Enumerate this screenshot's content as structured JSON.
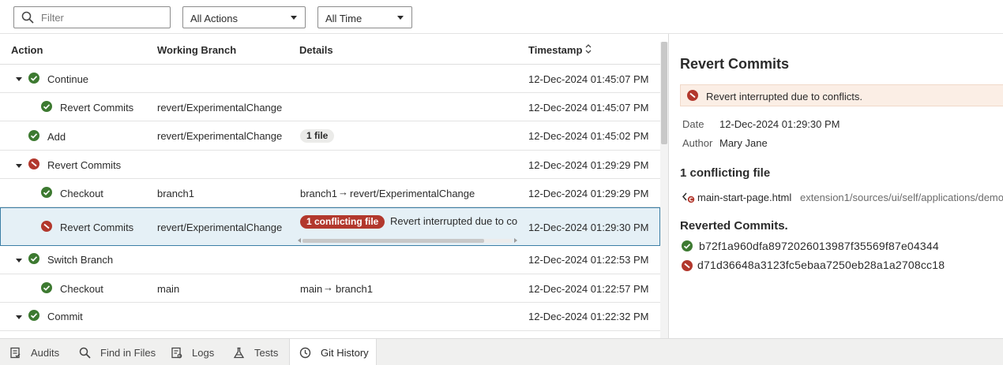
{
  "toolbar": {
    "filter_placeholder": "Filter",
    "action_select": "All Actions",
    "time_select": "All Time"
  },
  "table": {
    "columns": [
      "Action",
      "Working Branch",
      "Details",
      "Timestamp"
    ],
    "rows": [
      {
        "action": "Continue",
        "status": "ok",
        "branch": "",
        "details": "",
        "timestamp": "12-Dec-2024 01:45:07 PM",
        "expanded": true,
        "level": 0
      },
      {
        "action": "Revert Commits",
        "status": "ok",
        "branch": "revert/ExperimentalChange",
        "details": "",
        "timestamp": "12-Dec-2024 01:45:07 PM",
        "level": 1
      },
      {
        "action": "Add",
        "status": "ok",
        "branch": "revert/ExperimentalChange",
        "badge": "1 file",
        "timestamp": "12-Dec-2024 01:45:02 PM",
        "level": 0
      },
      {
        "action": "Revert Commits",
        "status": "err",
        "branch": "",
        "details": "",
        "timestamp": "12-Dec-2024 01:29:29 PM",
        "expanded": true,
        "level": 0
      },
      {
        "action": "Checkout",
        "status": "ok",
        "branch": "branch1",
        "from": "branch1",
        "to": "revert/ExperimentalChange",
        "timestamp": "12-Dec-2024 01:29:29 PM",
        "level": 1
      },
      {
        "action": "Revert Commits",
        "status": "err",
        "branch": "revert/ExperimentalChange",
        "badge": "1 conflicting file",
        "details": "Revert interrupted due to conflicts.",
        "timestamp": "12-Dec-2024 01:29:30 PM",
        "level": 1,
        "selected": true
      },
      {
        "action": "Switch Branch",
        "status": "ok",
        "branch": "",
        "details": "",
        "timestamp": "12-Dec-2024 01:22:53 PM",
        "expanded": true,
        "level": 0
      },
      {
        "action": "Checkout",
        "status": "ok",
        "branch": "main",
        "from": "main",
        "to": "branch1",
        "timestamp": "12-Dec-2024 01:22:57 PM",
        "level": 1
      },
      {
        "action": "Commit",
        "status": "ok",
        "branch": "",
        "details": "",
        "timestamp": "12-Dec-2024 01:22:32 PM",
        "expanded": true,
        "level": 0
      }
    ]
  },
  "detail": {
    "title": "Revert Commits",
    "alert": "Revert interrupted due to conflicts.",
    "date_label": "Date",
    "date_value": "12-Dec-2024 01:29:30 PM",
    "author_label": "Author",
    "author_value": "Mary Jane",
    "conflict_title": "1 conflicting file",
    "file_name": "main-start-page.html",
    "file_path": "extension1/sources/ui/self/applications/demo",
    "reverted_title": "Reverted Commits.",
    "commits": [
      {
        "hash": "b72f1a960dfa8972026013987f35569f87e04344",
        "status": "ok"
      },
      {
        "hash": "d71d36648a3123fc5ebaa7250eb28a1a2708cc18",
        "status": "err"
      }
    ]
  },
  "tabs": [
    {
      "label": "Audits",
      "icon": "audits-icon",
      "active": false
    },
    {
      "label": "Find in Files",
      "icon": "search-icon",
      "active": false
    },
    {
      "label": "Logs",
      "icon": "logs-icon",
      "active": false
    },
    {
      "label": "Tests",
      "icon": "flask-icon",
      "active": false
    },
    {
      "label": "Git History",
      "icon": "clock-icon",
      "active": true
    }
  ],
  "colors": {
    "success": "#3d7a31",
    "error": "#b2382d",
    "selected_row": "#e5f0f6",
    "alert_bg": "#fbeee5"
  }
}
